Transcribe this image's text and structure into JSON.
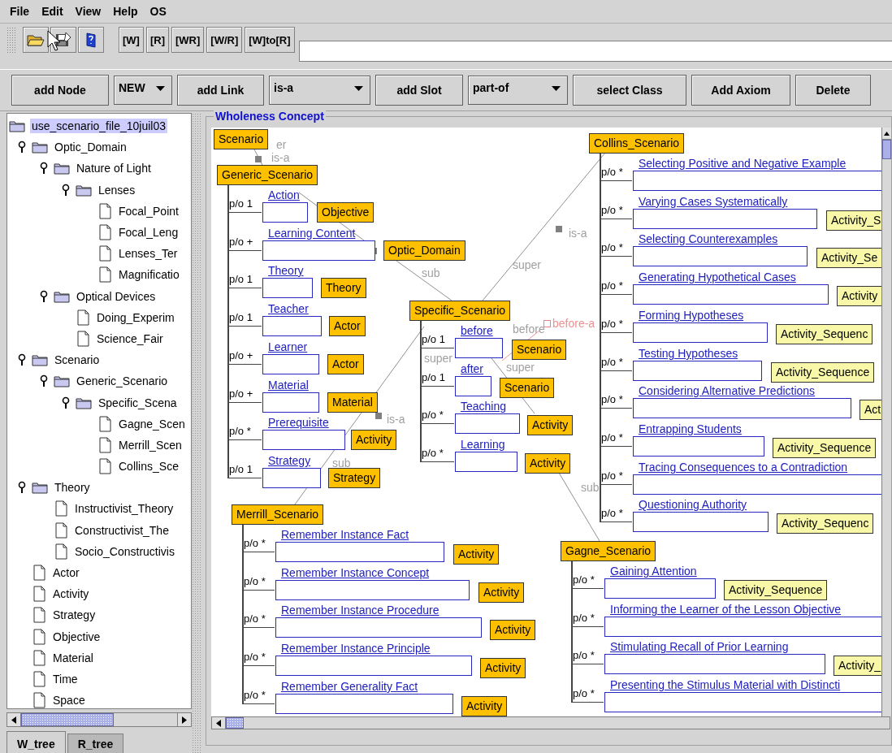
{
  "menu_bar": [
    "File",
    "Edit",
    "View",
    "Help",
    "OS"
  ],
  "toolbar": {
    "text_buttons": [
      "[W]",
      "[R]",
      "[WR]",
      "[W/R]",
      "[W]to[R]"
    ]
  },
  "edit_toolbar": [
    {
      "kind": "button",
      "label": "add Node"
    },
    {
      "kind": "combo",
      "value": "NEW"
    },
    {
      "kind": "button",
      "label": "add Link"
    },
    {
      "kind": "combo",
      "value": "is-a"
    },
    {
      "kind": "button",
      "label": "add Slot"
    },
    {
      "kind": "combo",
      "value": "part-of"
    },
    {
      "kind": "button",
      "label": "select Class"
    },
    {
      "kind": "button",
      "label": "Add Axiom"
    },
    {
      "kind": "button",
      "label": "Delete"
    }
  ],
  "tree": {
    "label": "use_scenario_file_10juil03",
    "selected": true,
    "children": [
      {
        "label": "Optic_Domain",
        "selected": false,
        "expanded": true,
        "children": [
          {
            "label": "Nature of Light",
            "selected": false,
            "expanded": true,
            "children": [
              {
                "label": "Lenses",
                "selected": false,
                "expanded": true,
                "children": [
                  {
                    "label": "Focal_Point",
                    "selected": false
                  },
                  {
                    "label": "Focal_Leng",
                    "selected": false
                  },
                  {
                    "label": "Lenses_Ter",
                    "selected": false
                  },
                  {
                    "label": "Magnificatio",
                    "selected": false
                  }
                ]
              }
            ]
          },
          {
            "label": "Optical Devices",
            "selected": false,
            "expanded": true,
            "children": [
              {
                "label": "Doing_Experim",
                "selected": false
              },
              {
                "label": "Science_Fair",
                "selected": false
              }
            ]
          }
        ]
      },
      {
        "label": "Scenario",
        "selected": false,
        "expanded": true,
        "children": [
          {
            "label": "Generic_Scenario",
            "selected": false,
            "expanded": true,
            "children": [
              {
                "label": "Specific_Scena",
                "selected": false,
                "expanded": true,
                "children": [
                  {
                    "label": "Gagne_Scen",
                    "selected": false
                  },
                  {
                    "label": "Merrill_Scen",
                    "selected": false
                  },
                  {
                    "label": "Collins_Sce",
                    "selected": false
                  }
                ]
              }
            ]
          }
        ]
      },
      {
        "label": "Theory",
        "selected": false,
        "expanded": true,
        "children": [
          {
            "label": "Instructivist_Theory",
            "selected": false
          },
          {
            "label": "Constructivist_The",
            "selected": false
          },
          {
            "label": "Socio_Constructivis",
            "selected": false
          }
        ]
      },
      {
        "label": "Actor",
        "selected": false
      },
      {
        "label": "Activity",
        "selected": false
      },
      {
        "label": "Strategy",
        "selected": false
      },
      {
        "label": "Objective",
        "selected": false
      },
      {
        "label": "Material",
        "selected": false
      },
      {
        "label": "Time",
        "selected": false
      },
      {
        "label": "Space",
        "selected": false
      }
    ]
  },
  "tabs": [
    {
      "label": "W_tree",
      "selected": true
    },
    {
      "label": "R_tree",
      "selected": false
    }
  ],
  "canvas": {
    "title": "Wholeness Concept",
    "link_labels": [
      {
        "text": "er",
        "kind": "relation"
      },
      {
        "text": "is-a",
        "kind": "relation"
      },
      {
        "text": "sub",
        "kind": "relation"
      },
      {
        "text": "super",
        "kind": "relation"
      },
      {
        "text": "is-a",
        "kind": "relation"
      },
      {
        "text": "before",
        "kind": "relation"
      },
      {
        "text": "before-a",
        "kind": "temporal"
      },
      {
        "text": "super",
        "kind": "relation"
      },
      {
        "text": "super",
        "kind": "relation"
      },
      {
        "text": "is-a",
        "kind": "relation"
      },
      {
        "text": "sub",
        "kind": "relation"
      },
      {
        "text": "sub",
        "kind": "relation"
      }
    ],
    "nodes": [
      {
        "label": "Scenario"
      }
    ],
    "frames": [
      {
        "title": "Generic_Scenario",
        "slots": [
          {
            "cardinality": "p/o 1",
            "name": "Action",
            "type": {
              "label": "Objective",
              "kind": "class"
            }
          },
          {
            "cardinality": "p/o +",
            "name": "Learning Content",
            "type": {
              "label": "Optic_Domain",
              "kind": "class"
            }
          },
          {
            "cardinality": "p/o 1",
            "name": "Theory",
            "type": {
              "label": "Theory",
              "kind": "class"
            }
          },
          {
            "cardinality": "p/o 1",
            "name": "Teacher",
            "type": {
              "label": "Actor",
              "kind": "class"
            }
          },
          {
            "cardinality": "p/o +",
            "name": "Learner",
            "type": {
              "label": "Actor",
              "kind": "class"
            }
          },
          {
            "cardinality": "p/o +",
            "name": "Material",
            "type": {
              "label": "Material",
              "kind": "class"
            }
          },
          {
            "cardinality": "p/o *",
            "name": "Prerequisite",
            "type": {
              "label": "Activity",
              "kind": "class"
            }
          },
          {
            "cardinality": "p/o 1",
            "name": "Strategy",
            "type": {
              "label": "Strategy",
              "kind": "class"
            }
          }
        ]
      },
      {
        "title": "Specific_Scenario",
        "slots": [
          {
            "cardinality": "p/o 1",
            "name": "before",
            "type": {
              "label": "Scenario",
              "kind": "class"
            }
          },
          {
            "cardinality": "p/o 1",
            "name": "after",
            "type": {
              "label": "Scenario",
              "kind": "class"
            }
          },
          {
            "cardinality": "p/o *",
            "name": "Teaching",
            "type": {
              "label": "Activity",
              "kind": "class"
            }
          },
          {
            "cardinality": "p/o *",
            "name": "Learning",
            "type": {
              "label": "Activity",
              "kind": "class"
            }
          }
        ]
      },
      {
        "title": "Collins_Scenario",
        "slots": [
          {
            "cardinality": "p/o *",
            "name": "Selecting Positive and Negative Example"
          },
          {
            "cardinality": "p/o *",
            "name": "Varying Cases Systematically",
            "type": {
              "label": "Activity_S",
              "kind": "sequence"
            }
          },
          {
            "cardinality": "p/o *",
            "name": "Selecting Counterexamples",
            "type": {
              "label": "Activity_Se",
              "kind": "sequence"
            }
          },
          {
            "cardinality": "p/o *",
            "name": "Generating Hypothetical Cases",
            "type": {
              "label": "Activity",
              "kind": "sequence"
            }
          },
          {
            "cardinality": "p/o *",
            "name": "Forming Hypotheses",
            "type": {
              "label": "Activity_Sequenc",
              "kind": "sequence"
            }
          },
          {
            "cardinality": "p/o *",
            "name": "Testing Hypotheses",
            "type": {
              "label": "Activity_Sequence",
              "kind": "sequence"
            }
          },
          {
            "cardinality": "p/o *",
            "name": "Considering Alternative Predictions",
            "type": {
              "label": "Act",
              "kind": "sequence"
            }
          },
          {
            "cardinality": "p/o *",
            "name": "Entrapping Students",
            "type": {
              "label": "Activity_Sequence",
              "kind": "sequence"
            }
          },
          {
            "cardinality": "p/o *",
            "name": "Tracing Consequences to a Contradiction"
          },
          {
            "cardinality": "p/o *",
            "name": "Questioning Authority",
            "type": {
              "label": "Activity_Sequenc",
              "kind": "sequence"
            }
          }
        ]
      },
      {
        "title": "Merrill_Scenario",
        "slots": [
          {
            "cardinality": "p/o *",
            "name": "Remember Instance Fact",
            "type": {
              "label": "Activity",
              "kind": "class"
            }
          },
          {
            "cardinality": "p/o *",
            "name": "Remember Instance Concept",
            "type": {
              "label": "Activity",
              "kind": "class"
            }
          },
          {
            "cardinality": "p/o *",
            "name": "Remember Instance Procedure",
            "type": {
              "label": "Activity",
              "kind": "class"
            }
          },
          {
            "cardinality": "p/o *",
            "name": "Remember Instance Principle",
            "type": {
              "label": "Activity",
              "kind": "class"
            }
          },
          {
            "cardinality": "p/o *",
            "name": "Remember Generality Fact",
            "type": {
              "label": "Activity",
              "kind": "class"
            }
          }
        ]
      },
      {
        "title": "Gagne_Scenario",
        "slots": [
          {
            "cardinality": "p/o *",
            "name": "Gaining Attention",
            "type": {
              "label": "Activity_Sequence",
              "kind": "sequence"
            }
          },
          {
            "cardinality": "p/o *",
            "name": "Informing the Learner of the Lesson Objective"
          },
          {
            "cardinality": "p/o *",
            "name": "Stimulating Recall of Prior Learning",
            "type": {
              "label": "Activity_",
              "kind": "sequence"
            }
          },
          {
            "cardinality": "p/o *",
            "name": "Presenting the Stimulus Material with Distincti"
          }
        ]
      }
    ]
  }
}
